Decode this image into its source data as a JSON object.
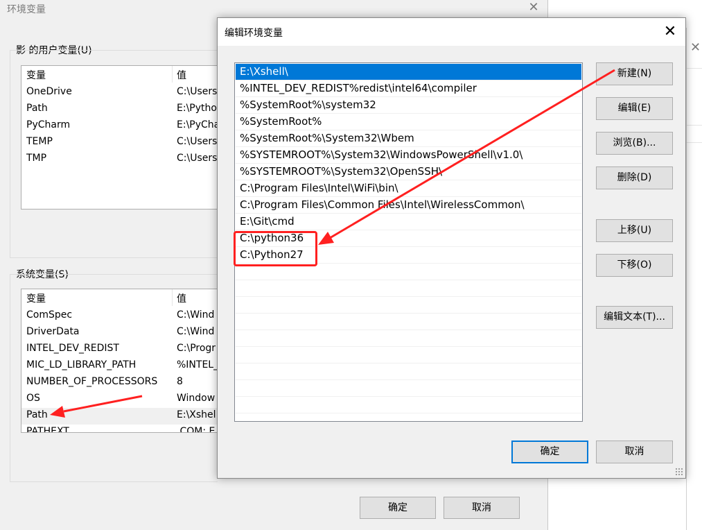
{
  "background_window": {
    "title": "环境变量",
    "close_glyph": "✕",
    "user_vars": {
      "group_label": "影 的用户变量(U)",
      "columns": [
        "变量",
        "值"
      ],
      "rows": [
        {
          "name": "OneDrive",
          "value": "C:\\Users"
        },
        {
          "name": "Path",
          "value": "E:\\Pytho"
        },
        {
          "name": "PyCharm",
          "value": "E:\\PyCha"
        },
        {
          "name": "TEMP",
          "value": "C:\\Users"
        },
        {
          "name": "TMP",
          "value": "C:\\Users"
        }
      ]
    },
    "system_vars": {
      "group_label": "系统变量(S)",
      "columns": [
        "变量",
        "值"
      ],
      "rows": [
        {
          "name": "ComSpec",
          "value": "C:\\Wind"
        },
        {
          "name": "DriverData",
          "value": "C:\\Wind"
        },
        {
          "name": "INTEL_DEV_REDIST",
          "value": "C:\\Progr"
        },
        {
          "name": "MIC_LD_LIBRARY_PATH",
          "value": "%INTEL_"
        },
        {
          "name": "NUMBER_OF_PROCESSORS",
          "value": "8"
        },
        {
          "name": "OS",
          "value": "Window"
        },
        {
          "name": "Path",
          "value": "E:\\Xshel"
        },
        {
          "name": "PATHEXT",
          "value": ".COM;.E"
        }
      ]
    },
    "ok_label": "确定",
    "cancel_label": "取消"
  },
  "third_window": {
    "close_glyph": "✕"
  },
  "edit_dialog": {
    "title": "编辑环境变量",
    "close_glyph": "✕",
    "entries": [
      "E:\\Xshell\\",
      "%INTEL_DEV_REDIST%redist\\intel64\\compiler",
      "%SystemRoot%\\system32",
      "%SystemRoot%",
      "%SystemRoot%\\System32\\Wbem",
      "%SYSTEMROOT%\\System32\\WindowsPowerShell\\v1.0\\",
      "%SYSTEMROOT%\\System32\\OpenSSH\\",
      "C:\\Program Files\\Intel\\WiFi\\bin\\",
      "C:\\Program Files\\Common Files\\Intel\\WirelessCommon\\",
      "E:\\Git\\cmd",
      "C:\\python36",
      "C:\\Python27"
    ],
    "selected_index": 0,
    "buttons": {
      "new": "新建(N)",
      "edit": "编辑(E)",
      "browse": "浏览(B)...",
      "delete": "删除(D)",
      "move_up": "上移(U)",
      "move_down": "下移(O)",
      "edit_text": "编辑文本(T)..."
    },
    "ok_label": "确定",
    "cancel_label": "取消"
  },
  "colors": {
    "selection": "#0078d7",
    "annotation": "#ff2020"
  }
}
